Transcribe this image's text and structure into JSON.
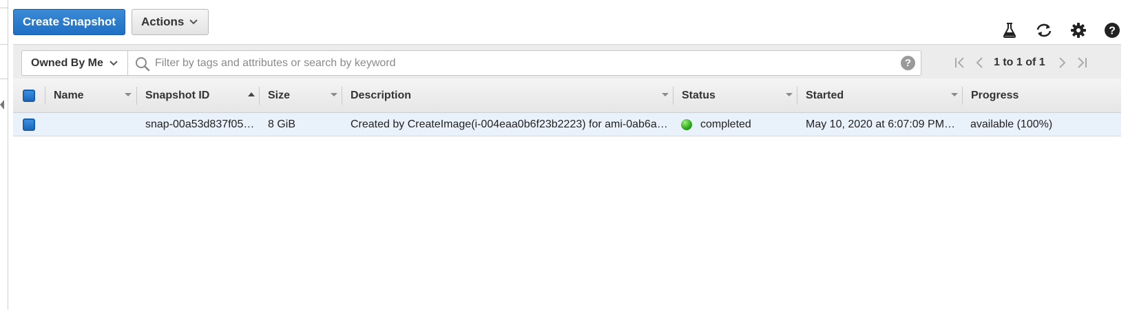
{
  "toolbar": {
    "create_label": "Create Snapshot",
    "actions_label": "Actions"
  },
  "top_icons": [
    "flask-icon",
    "refresh-icon",
    "gear-icon",
    "help-icon"
  ],
  "filter": {
    "owner_selected": "Owned By Me",
    "search_placeholder": "Filter by tags and attributes or search by keyword",
    "search_value": "",
    "help_glyph": "?"
  },
  "pagination": {
    "summary": "1 to 1 of 1"
  },
  "columns": [
    {
      "label": "Name",
      "sort": "none"
    },
    {
      "label": "Snapshot ID",
      "sort": "ascending"
    },
    {
      "label": "Size",
      "sort": "none"
    },
    {
      "label": "Description",
      "sort": "none"
    },
    {
      "label": "Status",
      "sort": "none"
    },
    {
      "label": "Started",
      "sort": "none"
    },
    {
      "label": "Progress",
      "sort": "none"
    }
  ],
  "rows": [
    {
      "selected": true,
      "name": "",
      "snapshot_id": "snap-00a53d837f05…",
      "size": "8 GiB",
      "description": "Created by CreateImage(i-004eaa0b6f23b2223) for ami-0ab6a…",
      "status": "completed",
      "started": "May 10, 2020 at 6:07:09 PM…",
      "progress": "available (100%)"
    }
  ],
  "colors": {
    "primary_button": "#1f6fc4",
    "status_completed": "#2aa51b",
    "selected_row": "#e9f1fb"
  }
}
